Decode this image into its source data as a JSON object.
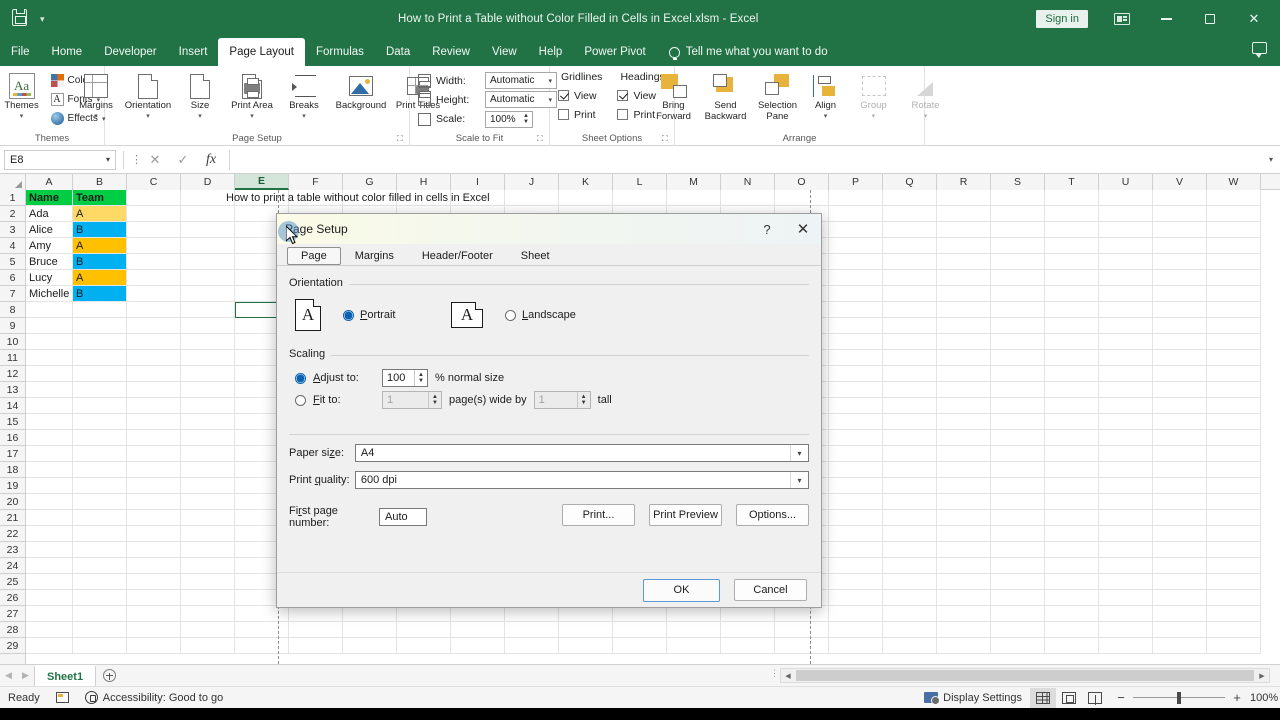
{
  "titlebar": {
    "document_title": "How to Print a Table without Color Filled in Cells in Excel.xlsm  -  Excel",
    "signin_label": "Sign in",
    "qat_save_icon": "save-icon",
    "qat_more_icon": "chevron-down-icon",
    "ribbon_display_icon": "ribbon-display-options-icon",
    "minimize_icon": "minimize-icon",
    "restore_icon": "restore-icon",
    "close_icon": "close-icon"
  },
  "tabs": [
    {
      "label": "File",
      "active": false
    },
    {
      "label": "Home",
      "active": false
    },
    {
      "label": "Developer",
      "active": false
    },
    {
      "label": "Insert",
      "active": false
    },
    {
      "label": "Page Layout",
      "active": true
    },
    {
      "label": "Formulas",
      "active": false
    },
    {
      "label": "Data",
      "active": false
    },
    {
      "label": "Review",
      "active": false
    },
    {
      "label": "View",
      "active": false
    },
    {
      "label": "Help",
      "active": false
    },
    {
      "label": "Power Pivot",
      "active": false
    }
  ],
  "tellme": "Tell me what you want to do",
  "ribbon": {
    "groups": [
      {
        "name": "Themes",
        "label": "Themes"
      },
      {
        "name": "Page Setup",
        "label": "Page Setup"
      },
      {
        "name": "Scale to Fit",
        "label": "Scale to Fit"
      },
      {
        "name": "Sheet Options",
        "label": "Sheet Options"
      },
      {
        "name": "Arrange",
        "label": "Arrange"
      }
    ],
    "themes": {
      "themes_label": "Themes",
      "colors_label": "Colors",
      "fonts_label": "Fonts",
      "effects_label": "Effects"
    },
    "page_setup": {
      "margins_label": "Margins",
      "orientation_label": "Orientation",
      "size_label": "Size",
      "print_area_label": "Print Area",
      "breaks_label": "Breaks",
      "background_label": "Background",
      "print_titles_label": "Print Titles"
    },
    "scale_to_fit": {
      "width_label": "Width:",
      "width_value": "Automatic",
      "height_label": "Height:",
      "height_value": "Automatic",
      "scale_label": "Scale:",
      "scale_value": "100%"
    },
    "sheet_options": {
      "gridlines_label": "Gridlines",
      "headings_label": "Headings",
      "gridlines_view_label": "View",
      "gridlines_view_checked": true,
      "gridlines_print_label": "Print",
      "gridlines_print_checked": false,
      "headings_view_label": "View",
      "headings_view_checked": true,
      "headings_print_label": "Print",
      "headings_print_checked": false
    },
    "arrange": {
      "bring_forward_label": "Bring Forward",
      "send_backward_label": "Send Backward",
      "selection_pane_label": "Selection Pane",
      "align_label": "Align",
      "group_label": "Group",
      "rotate_label": "Rotate"
    }
  },
  "formula_bar": {
    "name_box": "E8",
    "cancel_icon": "cancel-icon",
    "enter_icon": "check-icon",
    "function_icon": "fx-icon",
    "formula_value": ""
  },
  "grid": {
    "columns": [
      "A",
      "B",
      "C",
      "D",
      "E",
      "F",
      "G",
      "H",
      "I",
      "J",
      "K",
      "L",
      "M",
      "N",
      "O",
      "P",
      "Q",
      "R",
      "S",
      "T",
      "U",
      "V",
      "W"
    ],
    "selected_column": "E",
    "rows": [
      1,
      2,
      3,
      4,
      5,
      6,
      7,
      8,
      9,
      10,
      11,
      12,
      13,
      14,
      15,
      16,
      17,
      18,
      19,
      20,
      21,
      22,
      23,
      24,
      25,
      26,
      27,
      28,
      29
    ],
    "selected_cell": "E8",
    "table": {
      "headers": [
        "Name",
        "Team"
      ],
      "rows": [
        {
          "name": "Ada",
          "team": "A"
        },
        {
          "name": "Alice",
          "team": "B"
        },
        {
          "name": "Amy",
          "team": "A"
        },
        {
          "name": "Bruce",
          "team": "B"
        },
        {
          "name": "Lucy",
          "team": "A"
        },
        {
          "name": "Michelle",
          "team": "B"
        }
      ]
    },
    "banner_text": "How to print a table without color filled in cells in Excel",
    "colors": {
      "header_fill": "#00cc44",
      "team_a_fill": "#ffc000",
      "team_a_fill_row2": "#ffd966",
      "team_b_fill": "#00b0f0"
    }
  },
  "sheet_tabs": {
    "prev_icon": "chevron-left-icon",
    "next_icon": "chevron-right-icon",
    "sheets": [
      "Sheet1"
    ],
    "active_sheet": "Sheet1",
    "add_sheet_icon": "plus-circle-icon"
  },
  "status_bar": {
    "status": "Ready",
    "macro_record_icon": "macro-record-icon",
    "accessibility": "Accessibility: Good to go",
    "display_settings": "Display Settings",
    "view_normal_icon": "normal-view-icon",
    "view_page_layout_icon": "page-layout-view-icon",
    "view_page_break_icon": "page-break-view-icon",
    "zoom_out_label": "−",
    "zoom_in_label": "+",
    "zoom_level": "100%"
  },
  "dialog": {
    "title": "Page Setup",
    "help_label": "?",
    "close_label": "✕",
    "tabs": [
      {
        "label": "Page",
        "active": true
      },
      {
        "label": "Margins",
        "active": false
      },
      {
        "label": "Header/Footer",
        "active": false
      },
      {
        "label": "Sheet",
        "active": false
      }
    ],
    "orientation": {
      "legend": "Orientation",
      "portrait_label": "Portrait",
      "portrait_selected": true,
      "landscape_label": "Landscape",
      "landscape_selected": false,
      "page_glyph": "A"
    },
    "scaling": {
      "legend": "Scaling",
      "adjust_to_label": "Adjust to:",
      "adjust_to_selected": true,
      "adjust_to_value": "100",
      "normal_size_label": "% normal size",
      "fit_to_label": "Fit to:",
      "fit_to_selected": false,
      "fit_wide_value": "1",
      "pages_wide_by_label": "page(s) wide by",
      "fit_tall_value": "1",
      "tall_label": "tall"
    },
    "paper_size_label": "Paper size:",
    "paper_size_value": "A4",
    "print_quality_label": "Print quality:",
    "print_quality_value": "600 dpi",
    "first_page_number_label": "First page number:",
    "first_page_number_value": "Auto",
    "buttons": {
      "print": "Print...",
      "print_preview": "Print Preview",
      "options": "Options...",
      "ok": "OK",
      "cancel": "Cancel"
    }
  }
}
